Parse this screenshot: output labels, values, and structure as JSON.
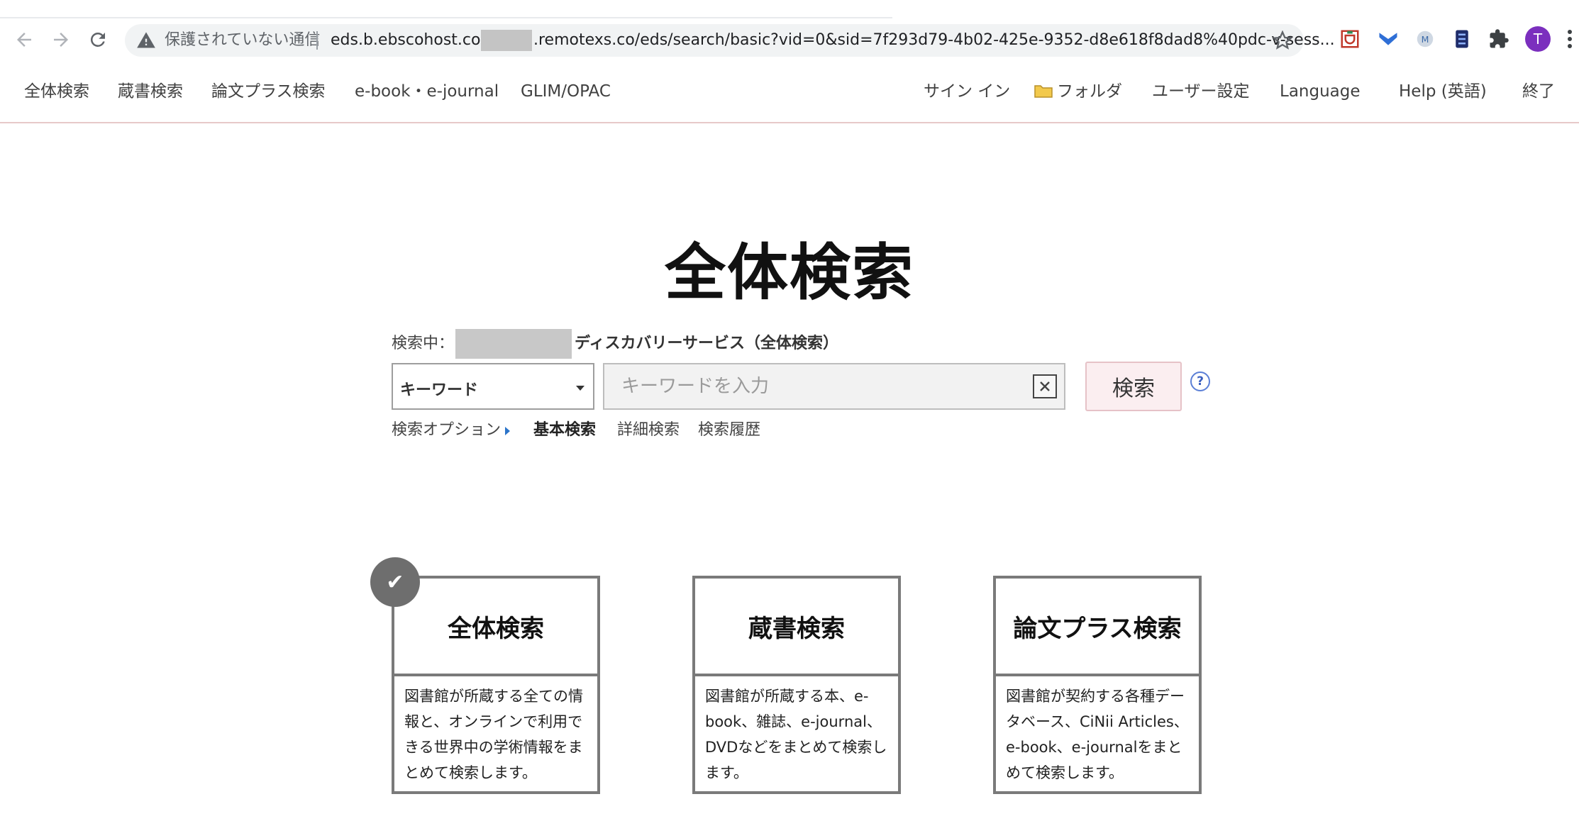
{
  "browser": {
    "status_text": "保護されていない通信",
    "url_part1": "eds.b.ebscohost.com",
    "url_part2": ".remotexs.co/eds/search/basic?vid=0&sid=7f293d79-4b02-425e-9352-d8e618f8dad8%40pdc-v-sess...",
    "avatar_letter": "T",
    "accent_color": "#7b2fbe"
  },
  "site_nav": {
    "left": [
      "全体検索",
      "蔵書検索",
      "論文プラス検索",
      "e-book・e-journal",
      "GLIM/OPAC"
    ],
    "sign_in": "サイン イン",
    "folder": "フォルダ",
    "user_settings": "ユーザー設定",
    "language": "Language",
    "help": "Help (英語)",
    "exit": "終了"
  },
  "main": {
    "title": "全体検索",
    "searching_label": "検索中：",
    "searching_service": "ディスカバリーサービス（全体検索）",
    "field_select": "キーワード",
    "search_placeholder": "キーワードを入力",
    "search_value": "",
    "search_button": "検索",
    "help_mark": "?",
    "options": {
      "search_options": "検索オプション",
      "basic": "基本検索",
      "advanced": "詳細検索",
      "history": "検索履歴"
    }
  },
  "cards": [
    {
      "title": "全体検索",
      "description": "図書館が所蔵する全ての情報と、オンラインで利用できる世界中の学術情報をまとめて検索します。",
      "selected": true
    },
    {
      "title": "蔵書検索",
      "description": "図書館が所蔵する本、e-book、雑誌、e-journal、DVDなどをまとめて検索します。",
      "selected": false
    },
    {
      "title": "論文プラス検索",
      "description": "図書館が契約する各種データベース、CiNii Articles、e-book、e-journalをまとめて検索します。",
      "selected": false
    }
  ],
  "check_mark": "✔"
}
